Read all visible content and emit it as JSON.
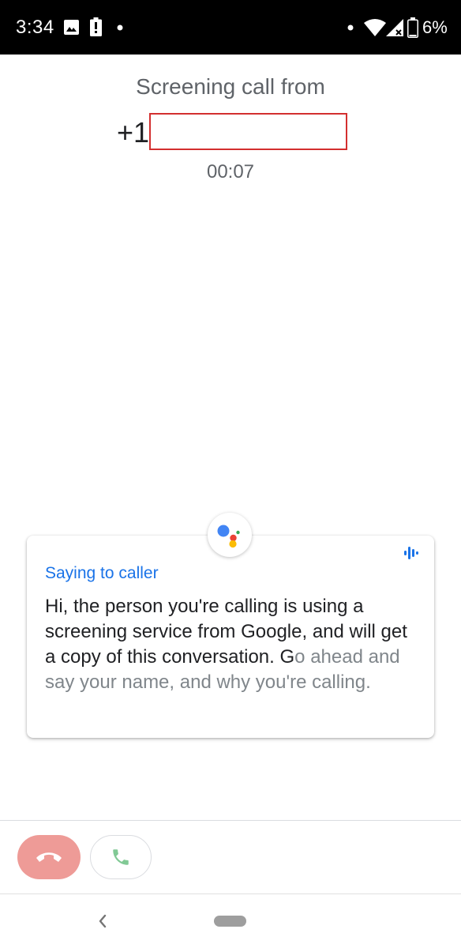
{
  "status_bar": {
    "time": "3:34",
    "battery_percent": "6%",
    "icons": [
      "image-icon",
      "battery-alert-icon",
      "notification-dot-icon",
      "wifi-icon",
      "cell-signal-icon",
      "battery-icon"
    ]
  },
  "call": {
    "title": "Screening call from",
    "number_prefix": "+1",
    "timer": "00:07"
  },
  "transcript_card": {
    "label": "Saying to caller",
    "text_main": "Hi, the person you're calling is using a screening service from Google, and will get a copy of this conversation. G",
    "text_faded": "o ahead and say your name, and why you're calling."
  },
  "actions": {
    "decline_icon": "call-end-icon",
    "answer_icon": "phone-icon"
  },
  "colors": {
    "accent_blue": "#1a73e8",
    "decline_red": "#ee9b97",
    "answer_green": "#34a853",
    "redaction_border": "#d32f2f"
  }
}
